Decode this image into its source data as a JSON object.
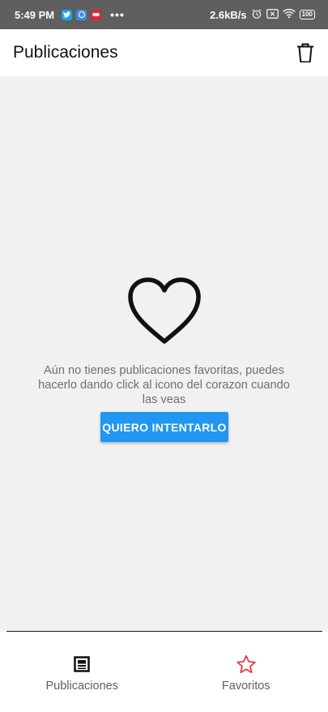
{
  "status_bar": {
    "time": "5:49 PM",
    "net_speed": "2.6kB/s",
    "battery": "100",
    "more": "•••"
  },
  "app_bar": {
    "title": "Publicaciones"
  },
  "empty_state": {
    "message": "Aún no tienes publicaciones favoritas, puedes hacerlo dando click al icono del corazon cuando las veas",
    "button_label": "QUIERO INTENTARLO"
  },
  "bottom_nav": {
    "items": [
      {
        "label": "Publicaciones",
        "icon": "article-icon"
      },
      {
        "label": "Favoritos",
        "icon": "star-icon"
      }
    ]
  },
  "colors": {
    "accent": "#2196f3",
    "favorite": "#e0444a",
    "status_bar": "#5f5f5f"
  }
}
